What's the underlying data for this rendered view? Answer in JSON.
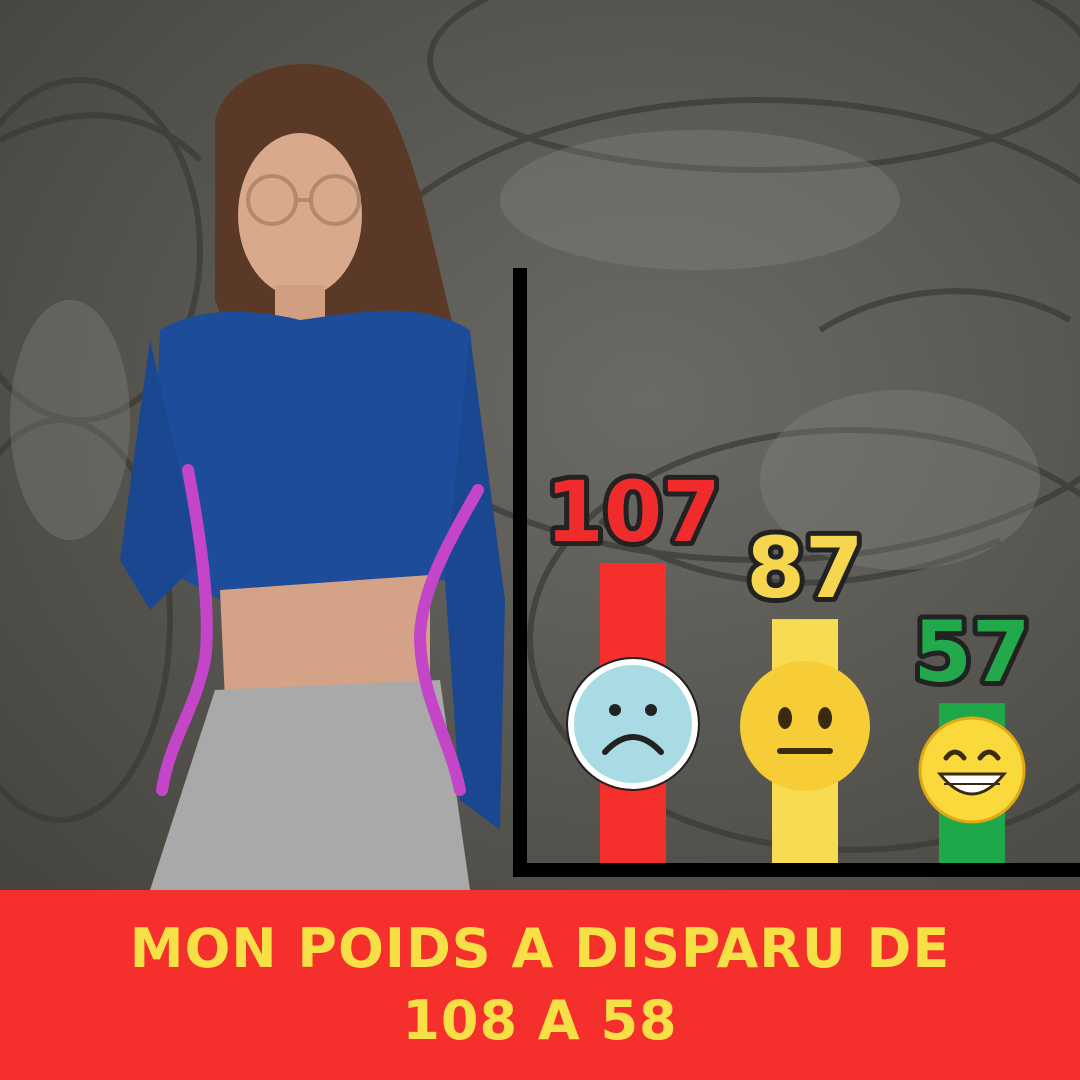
{
  "chart_data": {
    "type": "bar",
    "categories": [
      "107",
      "87",
      "57"
    ],
    "values": [
      107,
      87,
      57
    ],
    "bar_colors": [
      "#f5302c",
      "#f7dc52",
      "#1ea84a"
    ],
    "label_colors": [
      "#ef2b2b",
      "#f6d64e",
      "#21a94b"
    ],
    "icons": [
      "sad-face-icon",
      "neutral-face-icon",
      "grinning-face-icon"
    ],
    "ylim": [
      0,
      150
    ],
    "grid": false
  },
  "caption": {
    "line1": "MON POIDS A DISPARU DE",
    "line2": "108 A 58"
  },
  "colors": {
    "banner": "#f5302c",
    "caption_text": "#f7e046",
    "body_outline": "#c545c8",
    "axis": "#000000"
  }
}
